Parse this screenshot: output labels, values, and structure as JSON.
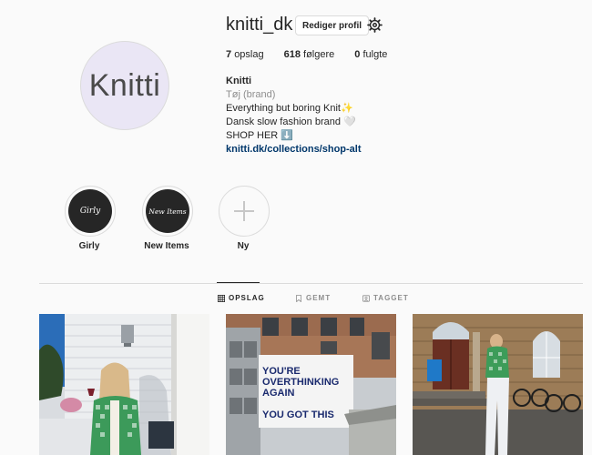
{
  "profile": {
    "avatar_text": "Knitti",
    "username": "knitti_dk",
    "edit_label": "Rediger profil",
    "stats": [
      {
        "count": "7",
        "label": "opslag"
      },
      {
        "count": "618",
        "label": "følgere"
      },
      {
        "count": "0",
        "label": "fulgte"
      }
    ],
    "bio": {
      "name": "Knitti",
      "category": "Tøj (brand)",
      "line1": "Everything but boring Knit✨",
      "line2": "Dansk slow fashion brand 🤍",
      "line3": "SHOP HER ⬇️",
      "link": "knitti.dk/collections/shop-alt"
    }
  },
  "highlights": [
    {
      "cover_text": "Girly",
      "label": "Girly"
    },
    {
      "cover_text": "New Items",
      "label": "New Items"
    },
    {
      "label": "Ny"
    }
  ],
  "tabs": [
    {
      "label": "OPSLAG",
      "icon": "grid-icon",
      "active": true
    },
    {
      "label": "GEMT",
      "icon": "bookmark-icon",
      "active": false
    },
    {
      "label": "TAGGET",
      "icon": "tag-icon",
      "active": false
    }
  ],
  "posts": [
    {
      "alt": "woman-in-green-knit"
    },
    {
      "sign_lines": [
        "YOU'RE",
        "OVERTHINKING",
        "AGAIN",
        "",
        "YOU GOT THIS"
      ]
    },
    {
      "alt": "street-scene-green-knit"
    }
  ]
}
